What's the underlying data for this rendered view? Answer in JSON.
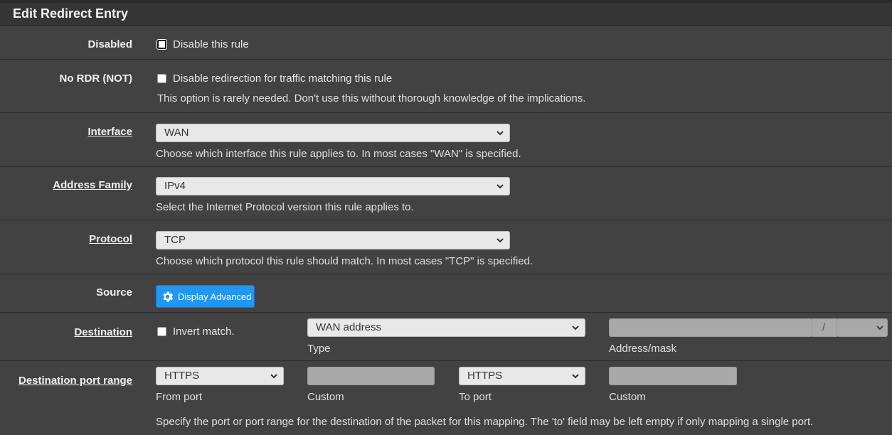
{
  "panel": {
    "title": "Edit Redirect Entry"
  },
  "disabled": {
    "label": "Disabled",
    "checkbox_text": "Disable this rule",
    "checked": false
  },
  "no_rdr": {
    "label": "No RDR (NOT)",
    "checkbox_text": "Disable redirection for traffic matching this rule",
    "help": "This option is rarely needed. Don't use this without thorough knowledge of the implications.",
    "checked": false
  },
  "interface": {
    "label": "Interface",
    "value": "WAN",
    "help": "Choose which interface this rule applies to. In most cases \"WAN\" is specified."
  },
  "address_family": {
    "label": "Address Family",
    "value": "IPv4",
    "help": "Select the Internet Protocol version this rule applies to."
  },
  "protocol": {
    "label": "Protocol",
    "value": "TCP",
    "help": "Choose which protocol this rule should match. In most cases \"TCP\" is specified."
  },
  "source": {
    "label": "Source",
    "button": "Display Advanced",
    "button_icon": "gear-icon"
  },
  "destination": {
    "label": "Destination",
    "invert_text": "Invert match.",
    "type_value": "WAN address",
    "type_caption": "Type",
    "address_value": "",
    "mask_separator": "/",
    "mask_value": "",
    "address_caption": "Address/mask"
  },
  "dest_port": {
    "label": "Destination port range",
    "from_value": "HTTPS",
    "from_caption": "From port",
    "from_custom": "",
    "from_custom_caption": "Custom",
    "to_value": "HTTPS",
    "to_caption": "To port",
    "to_custom": "",
    "to_custom_caption": "Custom",
    "help": "Specify the port or port range for the destination of the packet for this mapping. The 'to' field may be left empty if only mapping a single port."
  },
  "colors": {
    "accent": "#2196f3",
    "background": "#424242",
    "header": "#353535"
  }
}
